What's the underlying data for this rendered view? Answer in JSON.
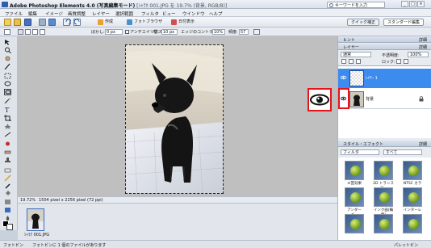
{
  "titlebar": {
    "app_title": "Adobe Photoshop Elements 4.0 (写真編集モード)",
    "doc_title": "[ｼｬﾗｸ 001.JPG を 19.7% (背景, RGB/8)]",
    "search_placeholder": "キーワードを入力"
  },
  "menubar": {
    "items": [
      "ファイル",
      "編集",
      "イメージ",
      "画質調整",
      "レイヤー",
      "選択範囲",
      "フィルタ",
      "ビュー",
      "ウインドウ",
      "ヘルプ"
    ]
  },
  "toolbar": {
    "create_label": "作成",
    "photo_browser_label": "フォトブラウザ",
    "date_view_label": "日付表示",
    "quick_fix_label": "クイック補正",
    "standard_edit_label": "スタンダード編集"
  },
  "options": {
    "feather_label": "ぼかし:",
    "feather_value": "0 px",
    "antialias_label": "アンチエイリアス",
    "width_label": "幅:",
    "width_value": "10 px",
    "edge_contrast_label": "エッジのコントラスト:",
    "edge_contrast_value": "10%",
    "frequency_label": "頻度:",
    "frequency_value": "57"
  },
  "status": {
    "zoom": "19.72%",
    "doc_size": "1504 pixel x 2256 pixel (72 ppi)"
  },
  "photo_bin": {
    "thumb_label": "ｼｬﾗｸ 001.JPG"
  },
  "bottombar": {
    "left_label": "フォトビン",
    "info": "フォトビンに 1 個のファイルがあります",
    "palette_bin_label": "パレットビン"
  },
  "panels": {
    "hints_title": "ヒント",
    "more_label": "詳細",
    "layers_title": "レイヤー",
    "blend_mode": "通常",
    "opacity_label": "不透明度:",
    "opacity_value": "100%",
    "lock_label": "ロック:",
    "layers": [
      {
        "name": "ﾚｲﾔｰ 1",
        "selected": true
      },
      {
        "name": "背景",
        "selected": false
      }
    ],
    "styles_title": "スタイル・エフェクト",
    "styles_category": "フィルタ",
    "styles_filter": "すべて",
    "style_items": [
      "エ芸効果",
      "2D トランスフ...",
      "NTSC カラー",
      "アンダーペ...",
      "インク画(輪郭)",
      "インターレー..."
    ]
  },
  "colors": {
    "accent_blue": "#3c8cf0",
    "highlight_red": "#e8141c"
  }
}
